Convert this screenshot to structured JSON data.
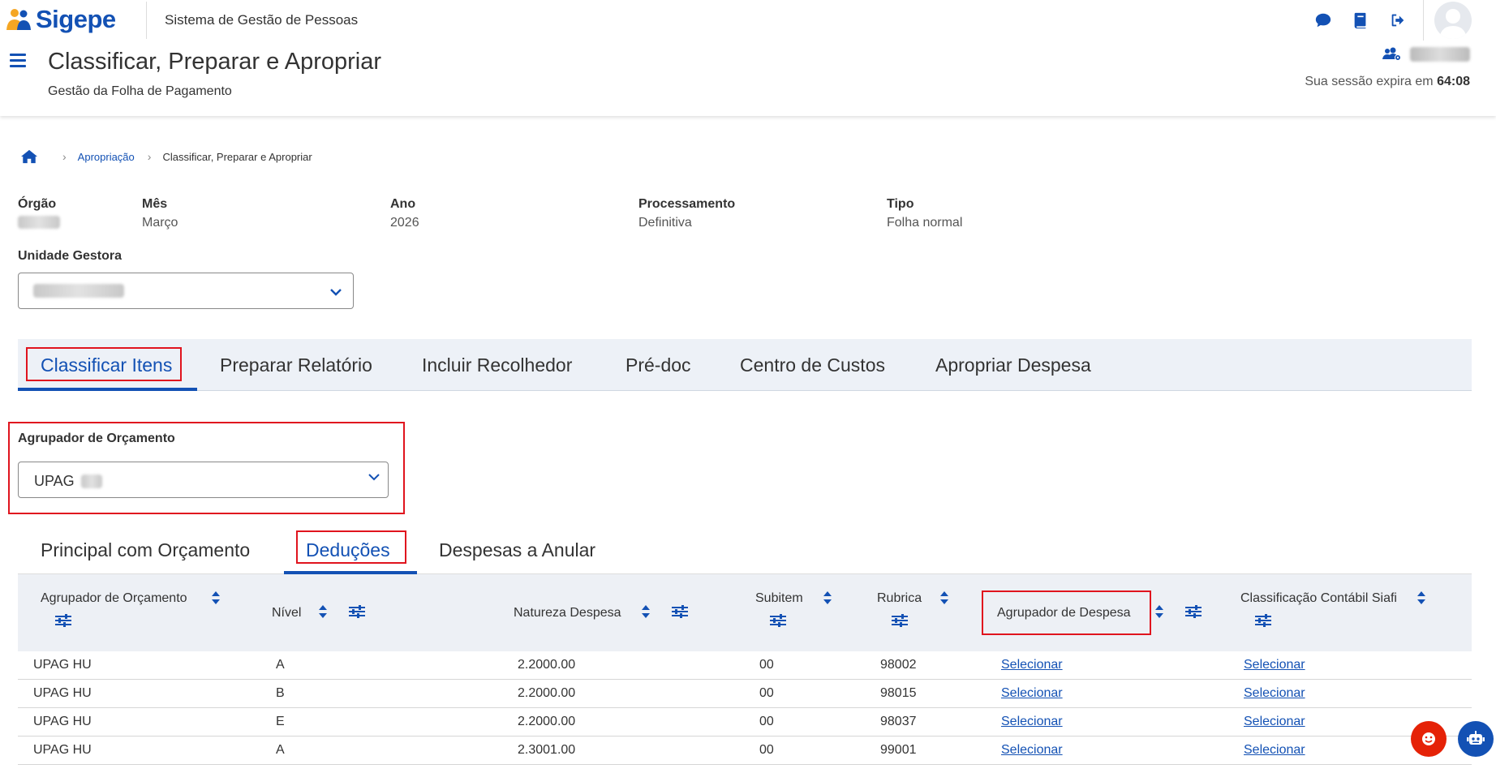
{
  "header": {
    "logo_text": "Sigepe",
    "system_name": "Sistema de Gestão de Pessoas",
    "page_title": "Classificar, Preparar e Apropriar",
    "page_subtitle": "Gestão da Folha de Pagamento",
    "session_prefix": "Sua sessão expira em",
    "session_time": "64:08"
  },
  "breadcrumb": {
    "items": [
      "Apropriação",
      "Classificar, Preparar e Apropriar"
    ]
  },
  "info": {
    "orgao_label": "Órgão",
    "mes_label": "Mês",
    "mes_value": "Março",
    "ano_label": "Ano",
    "ano_value": "2026",
    "processamento_label": "Processamento",
    "processamento_value": "Definitiva",
    "tipo_label": "Tipo",
    "tipo_value": "Folha normal",
    "unidade_label": "Unidade Gestora"
  },
  "tabs": [
    {
      "label": "Classificar Itens",
      "active": true
    },
    {
      "label": "Preparar Relatório",
      "active": false
    },
    {
      "label": "Incluir Recolhedor",
      "active": false
    },
    {
      "label": "Pré-doc",
      "active": false
    },
    {
      "label": "Centro de Custos",
      "active": false
    },
    {
      "label": "Apropriar Despesa",
      "active": false
    }
  ],
  "agrupador": {
    "label": "Agrupador de Orçamento",
    "value": "UPAG"
  },
  "subtabs": [
    {
      "label": "Principal com Orçamento",
      "active": false
    },
    {
      "label": "Deduções",
      "active": true
    },
    {
      "label": "Despesas a Anular",
      "active": false
    }
  ],
  "table": {
    "columns": [
      "Agrupador de Orçamento",
      "Nível",
      "Natureza Despesa",
      "Subitem",
      "Rubrica",
      "Agrupador de Despesa",
      "Classificação Contábil Siafi"
    ],
    "rows": [
      [
        "UPAG HU",
        "A",
        "2.2000.00",
        "00",
        "98002",
        "Selecionar",
        "Selecionar"
      ],
      [
        "UPAG HU",
        "B",
        "2.2000.00",
        "00",
        "98015",
        "Selecionar",
        "Selecionar"
      ],
      [
        "UPAG HU",
        "E",
        "2.2000.00",
        "00",
        "98037",
        "Selecionar",
        "Selecionar"
      ],
      [
        "UPAG HU",
        "A",
        "2.3001.00",
        "00",
        "99001",
        "Selecionar",
        "Selecionar"
      ]
    ]
  },
  "colors": {
    "primary": "#1351b4",
    "highlight": "#e0141e",
    "tab_bg": "#edf1f7"
  }
}
